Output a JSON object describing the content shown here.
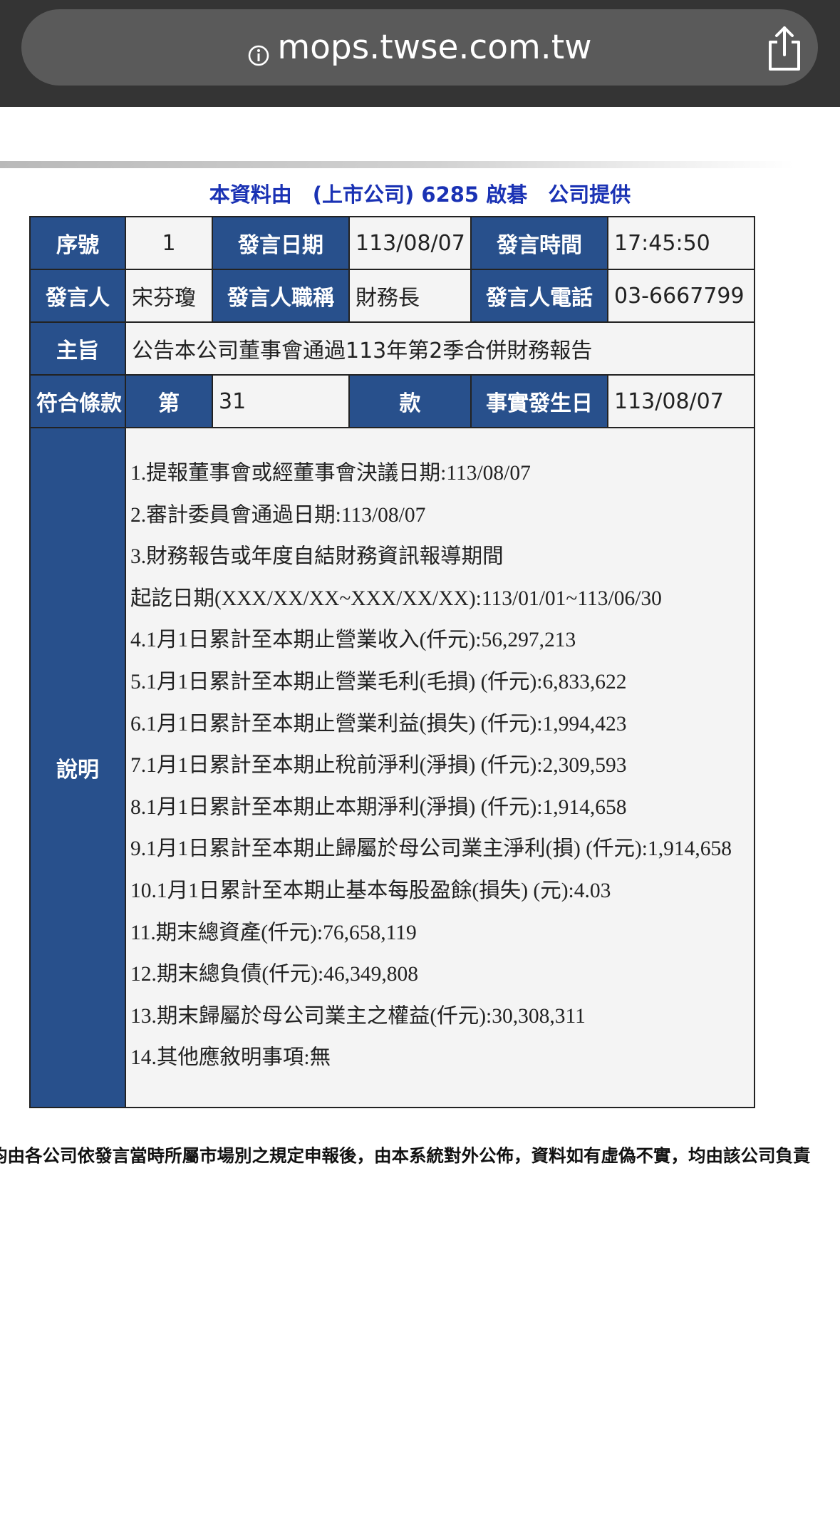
{
  "browser": {
    "url": "mops.twse.com.tw",
    "info_icon": "info-circle-icon",
    "share_icon": "share-icon"
  },
  "provider_line": "本資料由　(上市公司) 6285 啟碁　公司提供",
  "record": {
    "seq_label": "序號",
    "seq_value": "1",
    "date_label": "發言日期",
    "date_value": "113/08/07",
    "time_label": "發言時間",
    "time_value": "17:45:50",
    "speaker_label": "發言人",
    "speaker_value": "宋芬瓊",
    "title_label": "發言人職稱",
    "title_value": "財務長",
    "phone_label": "發言人電話",
    "phone_value": "03-6667799",
    "subject_label": "主旨",
    "subject_value": "公告本公司董事會通過113年第2季合併財務報告",
    "clause_label": "符合條款",
    "clause_di": "第",
    "clause_value": "31",
    "clause_kuan": "款",
    "fact_date_label": "事實發生日",
    "fact_date_value": "113/08/07",
    "desc_label": "說明"
  },
  "description_lines": [
    "1.提報董事會或經董事會決議日期:113/08/07",
    "2.審計委員會通過日期:113/08/07",
    "3.財務報告或年度自結財務資訊報導期間",
    "起訖日期(XXX/XX/XX~XXX/XX/XX):113/01/01~113/06/30",
    "4.1月1日累計至本期止營業收入(仟元):56,297,213",
    "5.1月1日累計至本期止營業毛利(毛損) (仟元):6,833,622",
    "6.1月1日累計至本期止營業利益(損失) (仟元):1,994,423",
    "7.1月1日累計至本期止稅前淨利(淨損) (仟元):2,309,593",
    "8.1月1日累計至本期止本期淨利(淨損) (仟元):1,914,658",
    "9.1月1日累計至本期止歸屬於母公司業主淨利(損) (仟元):1,914,658",
    "10.1月1日累計至本期止基本每股盈餘(損失) (元):4.03",
    "11.期末總資產(仟元):76,658,119",
    "12.期末總負債(仟元):46,349,808",
    "13.期末歸屬於母公司業主之權益(仟元):30,308,311",
    "14.其他應敘明事項:無"
  ],
  "footnote": "均由各公司依發言當時所屬市場別之規定申報後，由本系統對外公佈，資料如有虛偽不實，均由該公司負責"
}
